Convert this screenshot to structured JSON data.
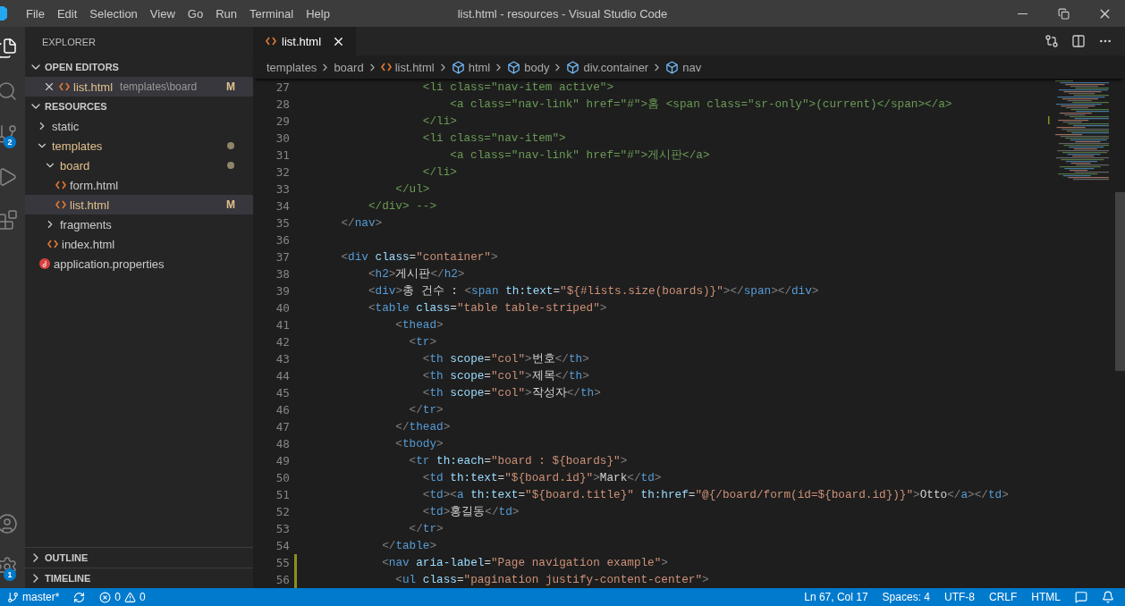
{
  "window": {
    "title": "list.html - resources - Visual Studio Code"
  },
  "menu": [
    "File",
    "Edit",
    "Selection",
    "View",
    "Go",
    "Run",
    "Terminal",
    "Help"
  ],
  "activity_bar": [
    {
      "kind": "files",
      "selected": true
    },
    {
      "kind": "search",
      "selected": false
    },
    {
      "kind": "source-control",
      "selected": false,
      "badge": "2"
    },
    {
      "kind": "run",
      "selected": false
    },
    {
      "kind": "extensions",
      "selected": false
    }
  ],
  "activity_bar_bottom": [
    {
      "kind": "account"
    },
    {
      "kind": "settings",
      "badge": "1"
    }
  ],
  "sidebar": {
    "title": "EXPLORER",
    "open_editors": {
      "title": "OPEN EDITORS",
      "expanded": true,
      "items": [
        {
          "label": "list.html",
          "path": "templates\\board",
          "status": "M",
          "selected": true
        }
      ]
    },
    "folder": {
      "title": "RESOURCES",
      "expanded": true,
      "items": [
        {
          "label": "static",
          "kind": "folder",
          "expanded": false,
          "modified": false,
          "selected": false
        },
        {
          "label": "templates",
          "kind": "folder",
          "expanded": true,
          "modified": true,
          "selected": false,
          "children": [
            {
              "label": "board",
              "kind": "folder",
              "expanded": true,
              "modified": true,
              "selected": false,
              "children": [
                {
                  "label": "form.html",
                  "kind": "html",
                  "modified": false,
                  "selected": false
                },
                {
                  "label": "list.html",
                  "kind": "html",
                  "modified": true,
                  "selected": true,
                  "status": "M"
                }
              ]
            },
            {
              "label": "fragments",
              "kind": "folder",
              "expanded": false,
              "modified": false,
              "selected": false
            },
            {
              "label": "index.html",
              "kind": "html",
              "modified": false,
              "selected": false
            }
          ]
        },
        {
          "label": "application.properties",
          "kind": "properties",
          "modified": false,
          "selected": false
        }
      ]
    },
    "panels": [
      {
        "title": "OUTLINE",
        "expanded": false
      },
      {
        "title": "TIMELINE",
        "expanded": false
      }
    ]
  },
  "tabs": [
    {
      "label": "list.html",
      "selected": true
    }
  ],
  "breadcrumbs": [
    {
      "label": "templates",
      "kind": "folder"
    },
    {
      "label": "board",
      "kind": "folder"
    },
    {
      "label": "list.html",
      "kind": "html"
    },
    {
      "label": "html",
      "kind": "element"
    },
    {
      "label": "body",
      "kind": "element"
    },
    {
      "label": "div.container",
      "kind": "element"
    },
    {
      "label": "nav",
      "kind": "element"
    }
  ],
  "code": [
    {
      "number": "27",
      "modified": false,
      "tokens": [
        {
          "kind": "comment",
          "text": "                <li class=\"nav-item active\">"
        }
      ]
    },
    {
      "number": "28",
      "modified": false,
      "tokens": [
        {
          "kind": "comment",
          "text": "                    <a class=\"nav-link\" href=\"#\">홈 <span class=\"sr-only\">(current)</span></a>"
        }
      ]
    },
    {
      "number": "29",
      "modified": false,
      "tokens": [
        {
          "kind": "comment",
          "text": "                </li>"
        }
      ]
    },
    {
      "number": "30",
      "modified": false,
      "tokens": [
        {
          "kind": "comment",
          "text": "                <li class=\"nav-item\">"
        }
      ]
    },
    {
      "number": "31",
      "modified": false,
      "tokens": [
        {
          "kind": "comment",
          "text": "                    <a class=\"nav-link\" href=\"#\">게시판</a>"
        }
      ]
    },
    {
      "number": "32",
      "modified": false,
      "tokens": [
        {
          "kind": "comment",
          "text": "                </li>"
        }
      ]
    },
    {
      "number": "33",
      "modified": false,
      "tokens": [
        {
          "kind": "comment",
          "text": "            </ul>"
        }
      ]
    },
    {
      "number": "34",
      "modified": false,
      "tokens": [
        {
          "kind": "comment",
          "text": "        </div> -->"
        }
      ]
    },
    {
      "number": "35",
      "modified": false,
      "tokens": [
        {
          "kind": "punct",
          "text": "    </"
        },
        {
          "kind": "tag",
          "text": "nav"
        },
        {
          "kind": "punct",
          "text": ">"
        }
      ]
    },
    {
      "number": "36",
      "modified": false
    },
    {
      "number": "37",
      "modified": false,
      "tokens": [
        {
          "kind": "punct",
          "text": "    <"
        },
        {
          "kind": "tag",
          "text": "div"
        },
        {
          "kind": "attr",
          "text": " class"
        },
        {
          "kind": "text",
          "text": "="
        },
        {
          "kind": "string",
          "text": "\"container\""
        },
        {
          "kind": "punct",
          "text": ">"
        }
      ]
    },
    {
      "number": "38",
      "modified": false,
      "tokens": [
        {
          "kind": "punct",
          "text": "        <"
        },
        {
          "kind": "tag",
          "text": "h2"
        },
        {
          "kind": "punct",
          "text": ">"
        },
        {
          "kind": "text",
          "text": "게시판"
        },
        {
          "kind": "punct",
          "text": "</"
        },
        {
          "kind": "tag",
          "text": "h2"
        },
        {
          "kind": "punct",
          "text": ">"
        }
      ]
    },
    {
      "number": "39",
      "modified": false,
      "tokens": [
        {
          "kind": "punct",
          "text": "        <"
        },
        {
          "kind": "tag",
          "text": "div"
        },
        {
          "kind": "punct",
          "text": ">"
        },
        {
          "kind": "text",
          "text": "총 건수 : "
        },
        {
          "kind": "punct",
          "text": "<"
        },
        {
          "kind": "tag",
          "text": "span"
        },
        {
          "kind": "attr",
          "text": " th:text"
        },
        {
          "kind": "text",
          "text": "="
        },
        {
          "kind": "string",
          "text": "\"${#lists.size(boards)}\""
        },
        {
          "kind": "punct",
          "text": "></"
        },
        {
          "kind": "tag",
          "text": "span"
        },
        {
          "kind": "punct",
          "text": "></"
        },
        {
          "kind": "tag",
          "text": "div"
        },
        {
          "kind": "punct",
          "text": ">"
        }
      ]
    },
    {
      "number": "40",
      "modified": false,
      "tokens": [
        {
          "kind": "punct",
          "text": "        <"
        },
        {
          "kind": "tag",
          "text": "table"
        },
        {
          "kind": "attr",
          "text": " class"
        },
        {
          "kind": "text",
          "text": "="
        },
        {
          "kind": "string",
          "text": "\"table table-striped\""
        },
        {
          "kind": "punct",
          "text": ">"
        }
      ]
    },
    {
      "number": "41",
      "modified": false,
      "tokens": [
        {
          "kind": "punct",
          "text": "            <"
        },
        {
          "kind": "tag",
          "text": "thead"
        },
        {
          "kind": "punct",
          "text": ">"
        }
      ]
    },
    {
      "number": "42",
      "modified": false,
      "tokens": [
        {
          "kind": "punct",
          "text": "              <"
        },
        {
          "kind": "tag",
          "text": "tr"
        },
        {
          "kind": "punct",
          "text": ">"
        }
      ]
    },
    {
      "number": "43",
      "modified": false,
      "tokens": [
        {
          "kind": "punct",
          "text": "                <"
        },
        {
          "kind": "tag",
          "text": "th"
        },
        {
          "kind": "attr",
          "text": " scope"
        },
        {
          "kind": "text",
          "text": "="
        },
        {
          "kind": "string",
          "text": "\"col\""
        },
        {
          "kind": "punct",
          "text": ">"
        },
        {
          "kind": "text",
          "text": "번호"
        },
        {
          "kind": "punct",
          "text": "</"
        },
        {
          "kind": "tag",
          "text": "th"
        },
        {
          "kind": "punct",
          "text": ">"
        }
      ]
    },
    {
      "number": "44",
      "modified": false,
      "tokens": [
        {
          "kind": "punct",
          "text": "                <"
        },
        {
          "kind": "tag",
          "text": "th"
        },
        {
          "kind": "attr",
          "text": " scope"
        },
        {
          "kind": "text",
          "text": "="
        },
        {
          "kind": "string",
          "text": "\"col\""
        },
        {
          "kind": "punct",
          "text": ">"
        },
        {
          "kind": "text",
          "text": "제목"
        },
        {
          "kind": "punct",
          "text": "</"
        },
        {
          "kind": "tag",
          "text": "th"
        },
        {
          "kind": "punct",
          "text": ">"
        }
      ]
    },
    {
      "number": "45",
      "modified": false,
      "tokens": [
        {
          "kind": "punct",
          "text": "                <"
        },
        {
          "kind": "tag",
          "text": "th"
        },
        {
          "kind": "attr",
          "text": " scope"
        },
        {
          "kind": "text",
          "text": "="
        },
        {
          "kind": "string",
          "text": "\"col\""
        },
        {
          "kind": "punct",
          "text": ">"
        },
        {
          "kind": "text",
          "text": "작성자"
        },
        {
          "kind": "punct",
          "text": "</"
        },
        {
          "kind": "tag",
          "text": "th"
        },
        {
          "kind": "punct",
          "text": ">"
        }
      ]
    },
    {
      "number": "46",
      "modified": false,
      "tokens": [
        {
          "kind": "punct",
          "text": "              </"
        },
        {
          "kind": "tag",
          "text": "tr"
        },
        {
          "kind": "punct",
          "text": ">"
        }
      ]
    },
    {
      "number": "47",
      "modified": false,
      "tokens": [
        {
          "kind": "punct",
          "text": "            </"
        },
        {
          "kind": "tag",
          "text": "thead"
        },
        {
          "kind": "punct",
          "text": ">"
        }
      ]
    },
    {
      "number": "48",
      "modified": false,
      "tokens": [
        {
          "kind": "punct",
          "text": "            <"
        },
        {
          "kind": "tag",
          "text": "tbody"
        },
        {
          "kind": "punct",
          "text": ">"
        }
      ]
    },
    {
      "number": "49",
      "modified": false,
      "tokens": [
        {
          "kind": "punct",
          "text": "              <"
        },
        {
          "kind": "tag",
          "text": "tr"
        },
        {
          "kind": "attr",
          "text": " th:each"
        },
        {
          "kind": "text",
          "text": "="
        },
        {
          "kind": "string",
          "text": "\"board : ${boards}\""
        },
        {
          "kind": "punct",
          "text": ">"
        }
      ]
    },
    {
      "number": "50",
      "modified": false,
      "tokens": [
        {
          "kind": "punct",
          "text": "                <"
        },
        {
          "kind": "tag",
          "text": "td"
        },
        {
          "kind": "attr",
          "text": " th:text"
        },
        {
          "kind": "text",
          "text": "="
        },
        {
          "kind": "string",
          "text": "\"${board.id}\""
        },
        {
          "kind": "punct",
          "text": ">"
        },
        {
          "kind": "text",
          "text": "Mark"
        },
        {
          "kind": "punct",
          "text": "</"
        },
        {
          "kind": "tag",
          "text": "td"
        },
        {
          "kind": "punct",
          "text": ">"
        }
      ]
    },
    {
      "number": "51",
      "modified": false,
      "tokens": [
        {
          "kind": "punct",
          "text": "                <"
        },
        {
          "kind": "tag",
          "text": "td"
        },
        {
          "kind": "punct",
          "text": "><"
        },
        {
          "kind": "tag",
          "text": "a"
        },
        {
          "kind": "attr",
          "text": " th:text"
        },
        {
          "kind": "text",
          "text": "="
        },
        {
          "kind": "string",
          "text": "\"${board.title}\""
        },
        {
          "kind": "attr",
          "text": " th:href"
        },
        {
          "kind": "text",
          "text": "="
        },
        {
          "kind": "string",
          "text": "\"@{/board/form(id=${board.id})}\""
        },
        {
          "kind": "punct",
          "text": ">"
        },
        {
          "kind": "text",
          "text": "Otto"
        },
        {
          "kind": "punct",
          "text": "</"
        },
        {
          "kind": "tag",
          "text": "a"
        },
        {
          "kind": "punct",
          "text": "></"
        },
        {
          "kind": "tag",
          "text": "td"
        },
        {
          "kind": "punct",
          "text": ">"
        }
      ]
    },
    {
      "number": "52",
      "modified": false,
      "tokens": [
        {
          "kind": "punct",
          "text": "                <"
        },
        {
          "kind": "tag",
          "text": "td"
        },
        {
          "kind": "punct",
          "text": ">"
        },
        {
          "kind": "text",
          "text": "홍길동"
        },
        {
          "kind": "punct",
          "text": "</"
        },
        {
          "kind": "tag",
          "text": "td"
        },
        {
          "kind": "punct",
          "text": ">"
        }
      ]
    },
    {
      "number": "53",
      "modified": false,
      "tokens": [
        {
          "kind": "punct",
          "text": "              </"
        },
        {
          "kind": "tag",
          "text": "tr"
        },
        {
          "kind": "punct",
          "text": ">"
        }
      ]
    },
    {
      "number": "54",
      "modified": false,
      "tokens": [
        {
          "kind": "punct",
          "text": "          </"
        },
        {
          "kind": "tag",
          "text": "table"
        },
        {
          "kind": "punct",
          "text": ">"
        }
      ]
    },
    {
      "number": "55",
      "modified": true,
      "tokens": [
        {
          "kind": "punct",
          "text": "          <"
        },
        {
          "kind": "tag",
          "text": "nav"
        },
        {
          "kind": "attr",
          "text": " aria-label"
        },
        {
          "kind": "text",
          "text": "="
        },
        {
          "kind": "string",
          "text": "\"Page navigation example\""
        },
        {
          "kind": "punct",
          "text": ">"
        }
      ]
    },
    {
      "number": "56",
      "modified": true,
      "tokens": [
        {
          "kind": "punct",
          "text": "            <"
        },
        {
          "kind": "tag",
          "text": "ul"
        },
        {
          "kind": "attr",
          "text": " class"
        },
        {
          "kind": "text",
          "text": "="
        },
        {
          "kind": "string",
          "text": "\"pagination justify-content-center\""
        },
        {
          "kind": "punct",
          "text": ">"
        }
      ]
    }
  ],
  "status_bar": {
    "branch": "master*",
    "errors": "0",
    "warnings": "0",
    "right": [
      "Ln 67, Col 17",
      "Spaces: 4",
      "UTF-8",
      "CRLF",
      "HTML"
    ]
  }
}
